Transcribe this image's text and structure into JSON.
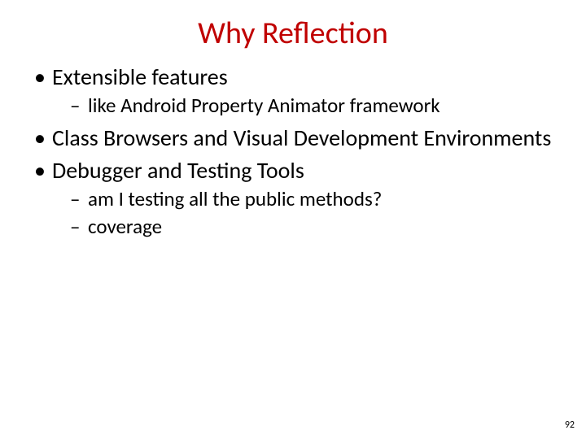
{
  "title": {
    "text": "Why Reflection",
    "color": "#C00000"
  },
  "bullets": [
    {
      "text": "Extensible features",
      "children": [
        {
          "text": "like Android Property Animator framework"
        }
      ]
    },
    {
      "text": "Class Browsers and Visual Development Environments",
      "children": []
    },
    {
      "text": "Debugger and Testing Tools",
      "children": [
        {
          "text": "am I testing all the public methods?"
        },
        {
          "text": "coverage"
        }
      ]
    }
  ],
  "page_number": "92"
}
